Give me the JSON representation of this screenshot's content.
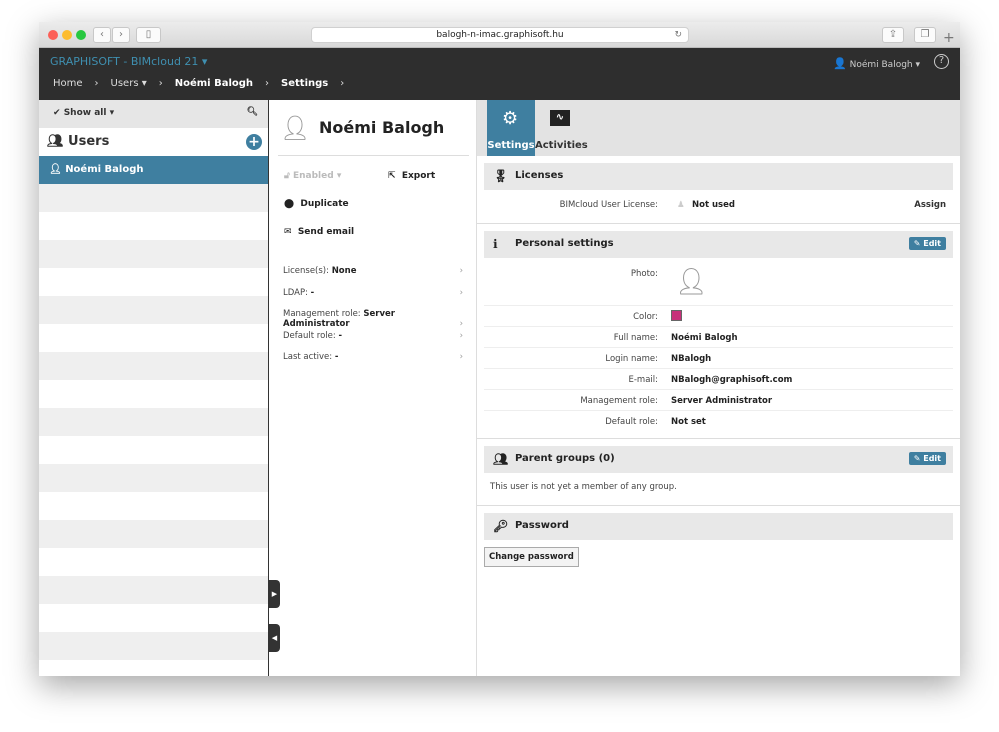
{
  "browser": {
    "url": "balogh-n-imac.graphisoft.hu"
  },
  "header": {
    "brand": "GRAPHISOFT - BIMcloud 21 ▾",
    "user": "Noémi Balogh ▾",
    "breadcrumb": [
      "Home",
      "Users ▾",
      "Noémi Balogh",
      "Settings"
    ]
  },
  "sidebar": {
    "filter": "Show all ▾",
    "title": "Users",
    "items": [
      "Noémi Balogh"
    ]
  },
  "middle": {
    "name": "Noémi Balogh",
    "enabled": "Enabled ▾",
    "export": "Export",
    "duplicate": "Duplicate",
    "send_email": "Send email",
    "props": [
      {
        "label": "License(s):",
        "value": "None"
      },
      {
        "label": "LDAP:",
        "value": "-"
      },
      {
        "label": "Management role:",
        "value": "Server Administrator"
      },
      {
        "label": "Default role:",
        "value": "-"
      },
      {
        "label": "Last active:",
        "value": "-"
      }
    ]
  },
  "tabs": [
    {
      "label": "Settings",
      "active": true
    },
    {
      "label": "Activities",
      "active": false
    }
  ],
  "licenses": {
    "title": "Licenses",
    "label": "BIMcloud User License:",
    "value": "Not used",
    "action": "Assign"
  },
  "personal": {
    "title": "Personal settings",
    "edit": "✎ Edit",
    "photo_label": "Photo:",
    "color_label": "Color:",
    "color": "#c7317a",
    "rows": [
      {
        "label": "Full name:",
        "value": "Noémi Balogh"
      },
      {
        "label": "Login name:",
        "value": "NBalogh"
      },
      {
        "label": "E-mail:",
        "value": "NBalogh@graphisoft.com"
      },
      {
        "label": "Management role:",
        "value": "Server Administrator"
      },
      {
        "label": "Default role:",
        "value": "Not set"
      }
    ]
  },
  "groups": {
    "title": "Parent groups (0)",
    "edit": "✎ Edit",
    "empty": "This user is not yet a member of any group."
  },
  "password": {
    "title": "Password",
    "button": "Change password"
  }
}
